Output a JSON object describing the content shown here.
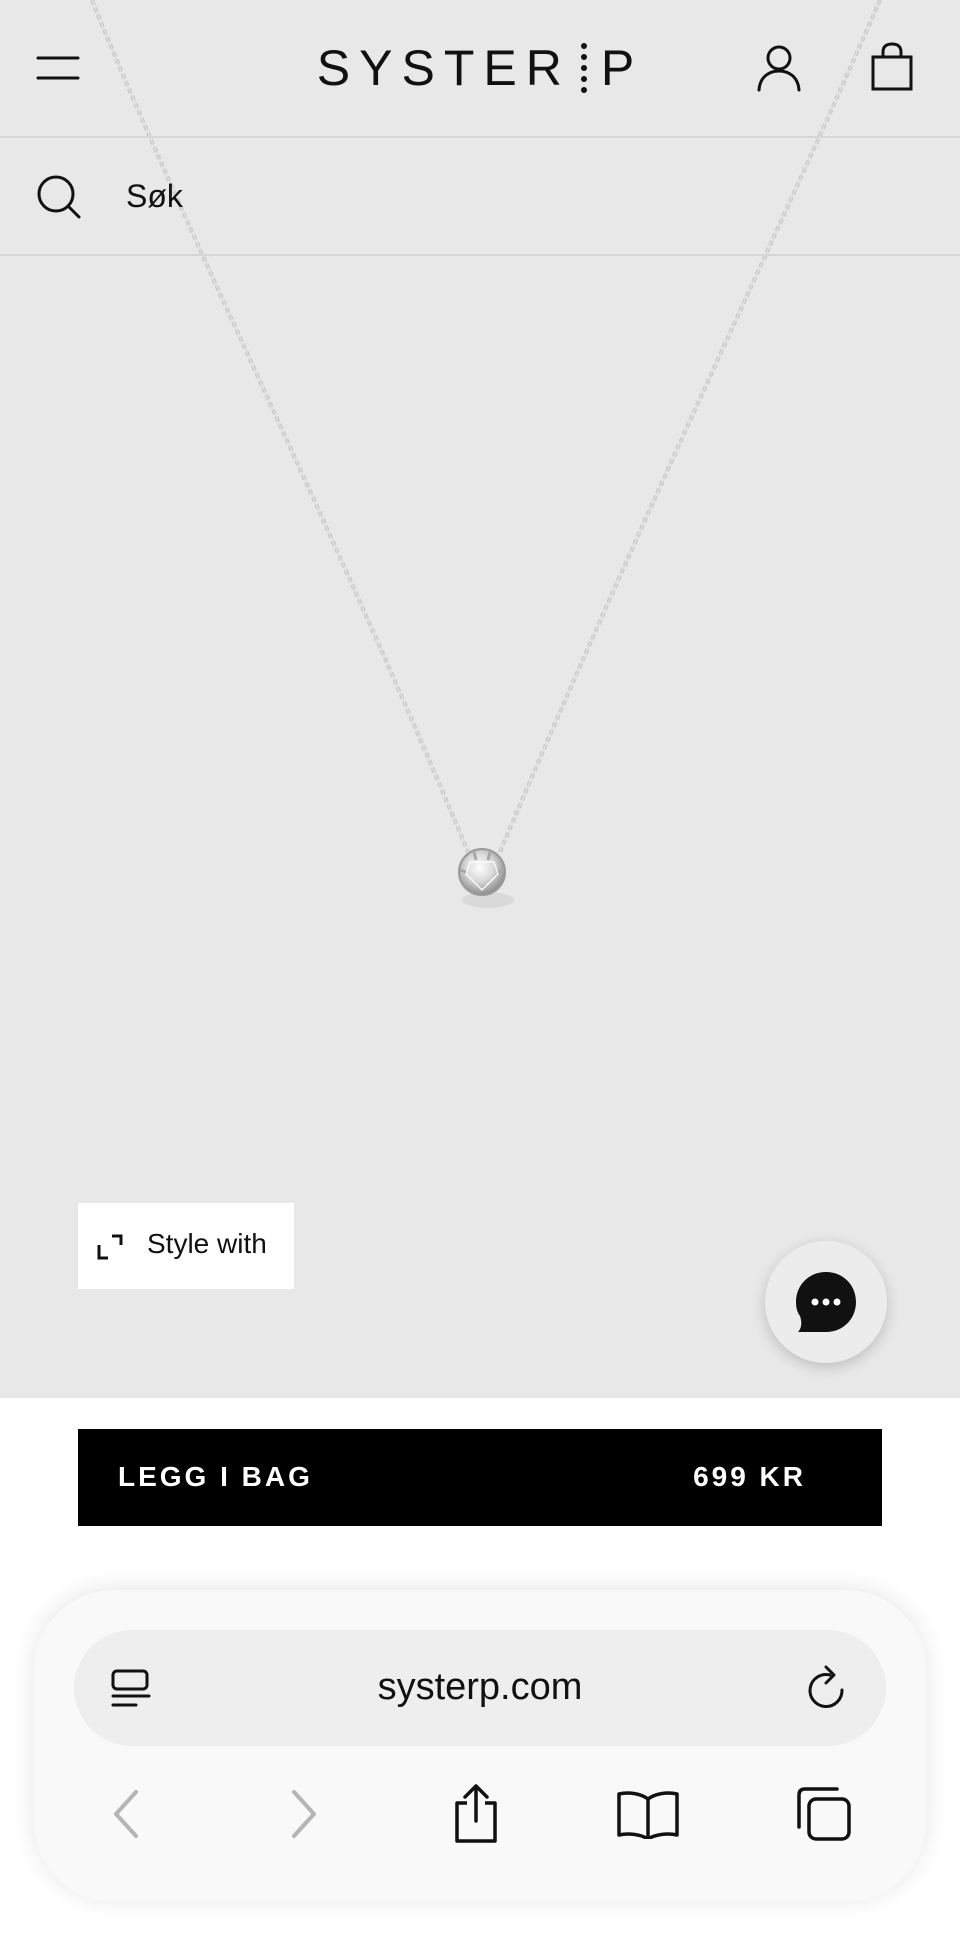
{
  "header": {
    "logo_left": "SYSTER",
    "logo_right": "P",
    "menu_icon": "hamburger-icon",
    "account_icon": "user-icon",
    "bag_icon": "shopping-bag-icon"
  },
  "search": {
    "icon": "search-icon",
    "label": "Søk"
  },
  "product_image": {
    "subject": "necklace-icon"
  },
  "style_with": {
    "icon": "expand-icon",
    "label": "Style with"
  },
  "chat": {
    "icon": "chat-bubble-icon"
  },
  "add_to_bag": {
    "label": "LEGG I BAG",
    "price": "699 KR"
  },
  "browser": {
    "url": "systerp.com",
    "reader_icon": "reader-icon",
    "reload_icon": "reload-icon",
    "back_icon": "back-icon",
    "forward_icon": "forward-icon",
    "share_icon": "share-icon",
    "bookmarks_icon": "bookmarks-icon",
    "tabs_icon": "tabs-icon"
  },
  "colors": {
    "background": "#e8e8e8",
    "cta": "#000000",
    "browser_bar": "#f9f9f9"
  }
}
